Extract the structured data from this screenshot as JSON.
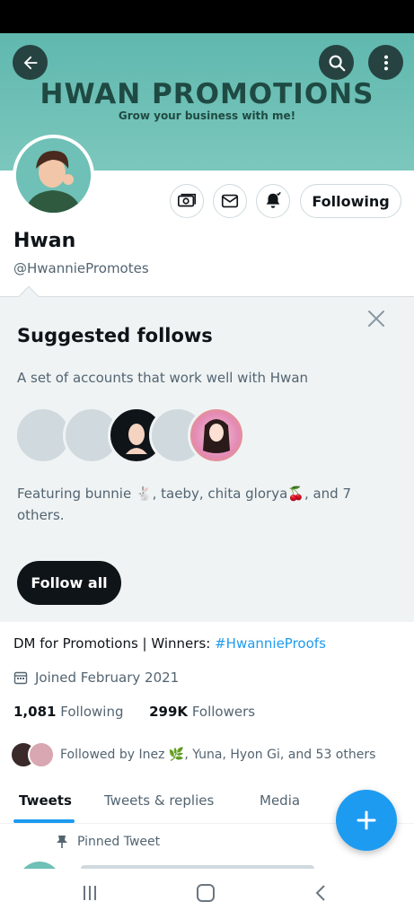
{
  "banner": {
    "title": "HWAN PROMOTIONS",
    "subtitle": "Grow your business with me!",
    "bg_color": "#6fc0b6"
  },
  "toolbar": {
    "back_icon": "arrow-left-icon",
    "search_icon": "search-icon",
    "more_icon": "more-vertical-icon"
  },
  "profile": {
    "display_name": "Hwan",
    "handle": "@HwanniePromotes",
    "following_label": "Following",
    "actions": [
      "money-icon",
      "mail-icon",
      "bell-check-icon"
    ],
    "bio_text": "DM for Promotions | Winners: ",
    "bio_hashtag": "#HwannieProofs",
    "joined": "Joined February 2021",
    "following_count": "1,081",
    "following_label_text": "Following",
    "followers_count": "299K",
    "followers_label_text": "Followers",
    "followed_by": "Followed by Inez 🌿, Yuna, Hyon Gi, and 53 others"
  },
  "suggested": {
    "title": "Suggested follows",
    "description": "A set of accounts that work well with Hwan",
    "featuring": "Featuring bunnie 🐇, taeby, chita glorya🍒, and 7 others.",
    "follow_all_label": "Follow all"
  },
  "tabs": [
    {
      "label": "Tweets",
      "active": true
    },
    {
      "label": "Tweets & replies",
      "active": false
    },
    {
      "label": "Media",
      "active": false
    }
  ],
  "pinned_label": "Pinned Tweet",
  "colors": {
    "accent": "#1d9bf0",
    "text_primary": "#0f1419",
    "text_secondary": "#536471"
  }
}
